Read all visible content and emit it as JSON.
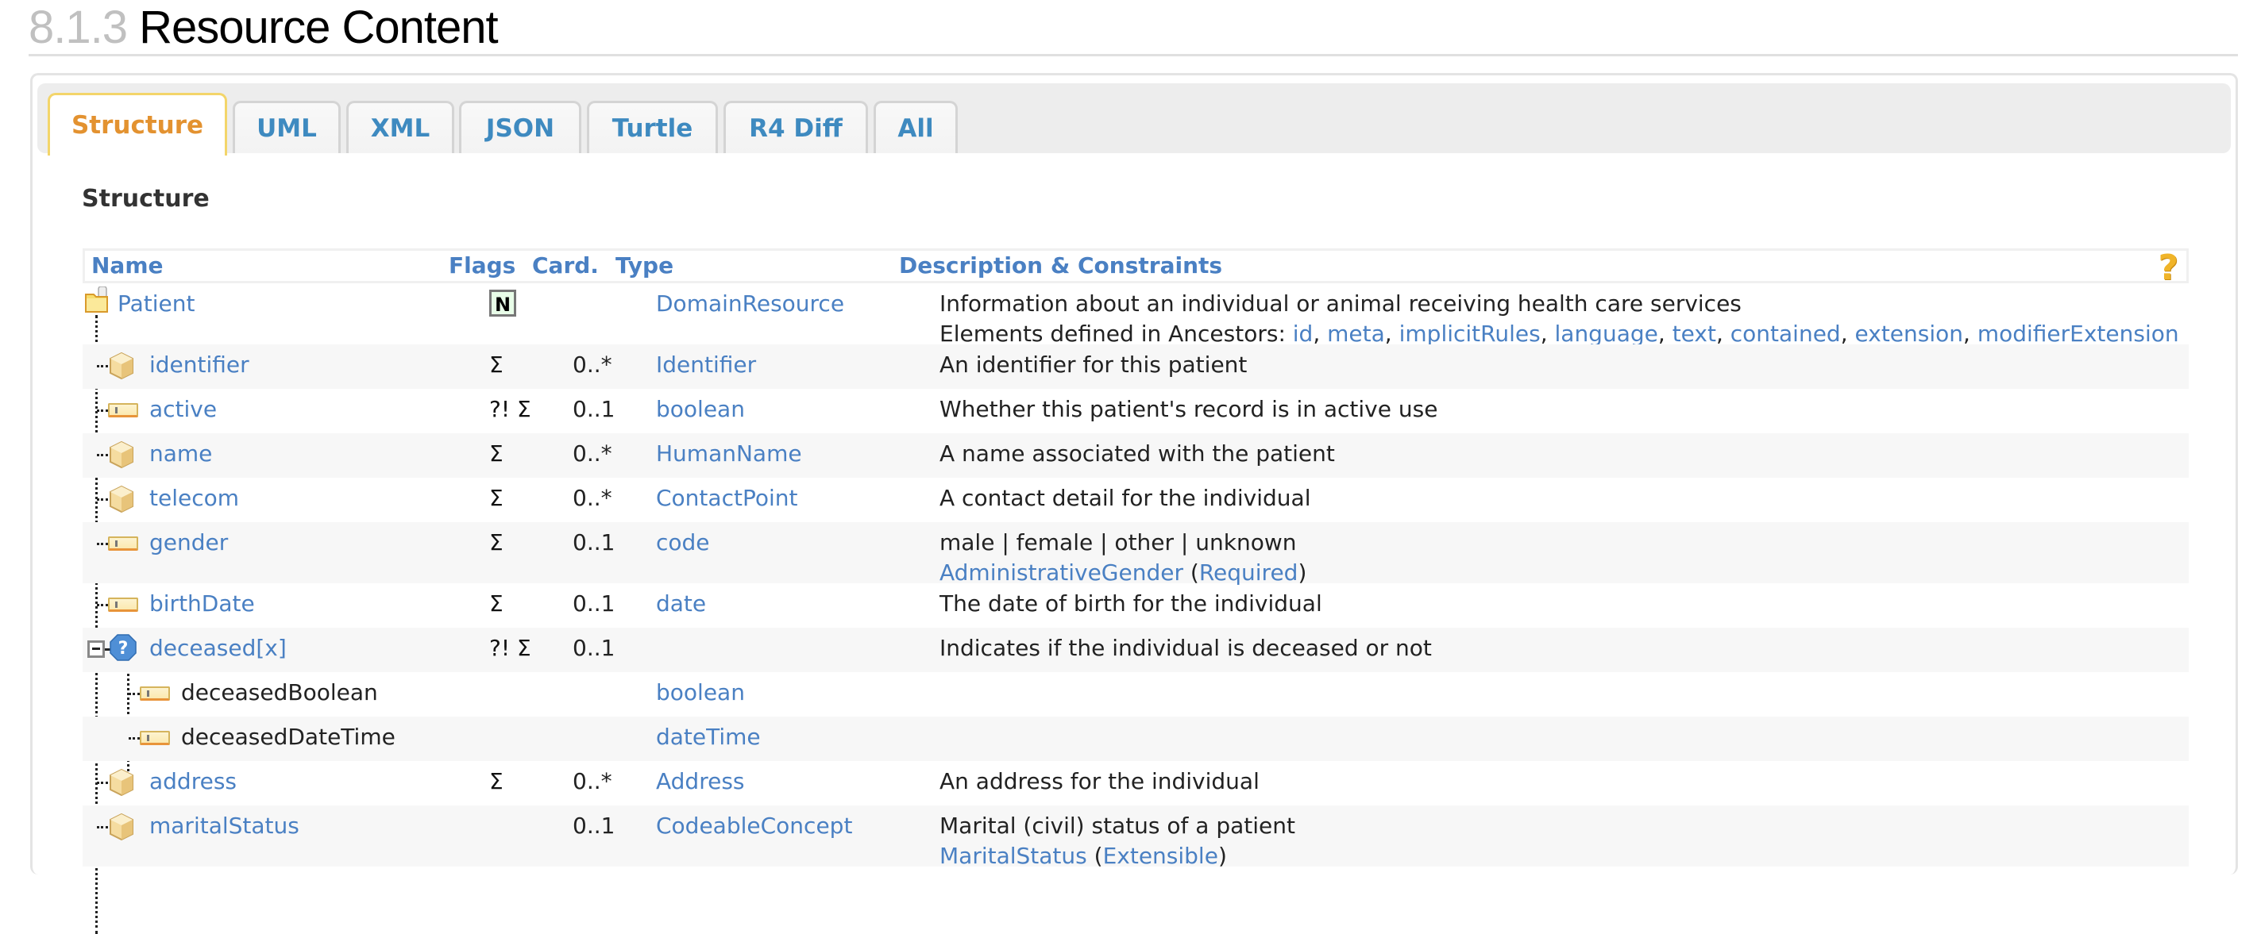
{
  "page": {
    "section_number": "8.1.3",
    "title": "Resource Content"
  },
  "tabs": [
    {
      "label": "Structure",
      "active": true
    },
    {
      "label": "UML",
      "active": false
    },
    {
      "label": "XML",
      "active": false
    },
    {
      "label": "JSON",
      "active": false
    },
    {
      "label": "Turtle",
      "active": false
    },
    {
      "label": "R4 Diff",
      "active": false
    },
    {
      "label": "All",
      "active": false
    }
  ],
  "section_heading": "Structure",
  "table": {
    "headers": {
      "name": "Name",
      "flags": "Flags",
      "card": "Card.",
      "type": "Type",
      "desc": "Description & Constraints",
      "help_icon": "?"
    },
    "rows": [
      {
        "name": "Patient",
        "icon": "resource-folder-icon",
        "flags": "N",
        "card": "",
        "type": "DomainResource",
        "desc": "Information about an individual or animal receiving health care services",
        "desc_line2_prefix": "Elements defined in Ancestors: ",
        "ancestors": [
          "id",
          "meta",
          "implicitRules",
          "language",
          "text",
          "contained",
          "extension",
          "modifierExtension"
        ]
      },
      {
        "name": "identifier",
        "icon": "datatype-icon",
        "flags": "Σ",
        "card": "0..*",
        "type": "Identifier",
        "desc": "An identifier for this patient"
      },
      {
        "name": "active",
        "icon": "primitive-icon",
        "flags": "?! Σ",
        "card": "0..1",
        "type": "boolean",
        "desc": "Whether this patient's record is in active use"
      },
      {
        "name": "name",
        "icon": "datatype-icon",
        "flags": "Σ",
        "card": "0..*",
        "type": "HumanName",
        "desc": "A name associated with the patient"
      },
      {
        "name": "telecom",
        "icon": "datatype-icon",
        "flags": "Σ",
        "card": "0..*",
        "type": "ContactPoint",
        "desc": "A contact detail for the individual"
      },
      {
        "name": "gender",
        "icon": "primitive-icon",
        "flags": "Σ",
        "card": "0..1",
        "type": "code",
        "desc": "male | female | other | unknown",
        "binding": {
          "valueset": "AdministrativeGender",
          "strength": "Required"
        }
      },
      {
        "name": "birthDate",
        "icon": "primitive-icon",
        "flags": "Σ",
        "card": "0..1",
        "type": "date",
        "desc": "The date of birth for the individual"
      },
      {
        "name": "deceased[x]",
        "icon": "choice-icon",
        "flags": "?! Σ",
        "card": "0..1",
        "type": "",
        "desc": "Indicates if the individual is deceased or not"
      },
      {
        "name": "deceasedBoolean",
        "icon": "primitive-icon",
        "flags": "",
        "card": "",
        "type": "boolean",
        "desc": ""
      },
      {
        "name": "deceasedDateTime",
        "icon": "primitive-icon",
        "flags": "",
        "card": "",
        "type": "dateTime",
        "desc": ""
      },
      {
        "name": "address",
        "icon": "datatype-icon",
        "flags": "Σ",
        "card": "0..*",
        "type": "Address",
        "desc": "An address for the individual"
      },
      {
        "name": "maritalStatus",
        "icon": "datatype-icon",
        "flags": "",
        "card": "0..1",
        "type": "CodeableConcept",
        "desc": "Marital (civil) status of a patient",
        "binding": {
          "valueset": "MaritalStatus",
          "strength": "Extensible"
        }
      }
    ]
  },
  "colors": {
    "link": "#4a80c3",
    "tab_link": "#3e8ac0",
    "tab_active": "#e39230",
    "tab_active_border": "#f3d56a",
    "title_number": "#c0c0c0",
    "help_icon": "#f0b429",
    "badge_bg": "#e8fde8",
    "row_alt": "#f7f7f7"
  }
}
